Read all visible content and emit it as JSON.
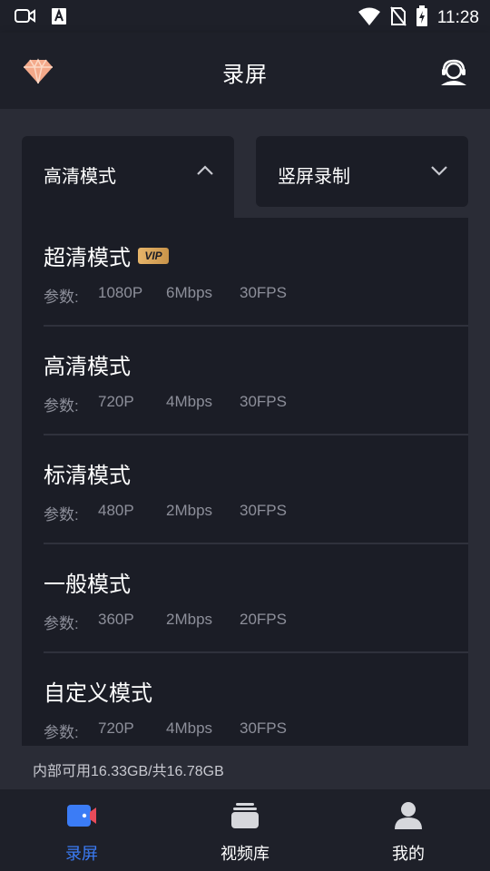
{
  "status_bar": {
    "time": "11:28",
    "icons": [
      "screen-record-icon",
      "font-a-icon",
      "wifi-icon",
      "no-sim-icon",
      "battery-charging-icon"
    ]
  },
  "app_bar": {
    "title": "录屏",
    "left_icon": "diamond-icon",
    "right_icon": "customer-service-icon"
  },
  "selectors": {
    "mode": {
      "label": "高清模式",
      "icon": "chevron-up-icon"
    },
    "orientation": {
      "label": "竖屏录制",
      "icon": "chevron-down-icon"
    }
  },
  "quality_options": [
    {
      "name": "超清模式",
      "badge": "VIP",
      "params_label": "参数:",
      "resolution": "1080P",
      "bitrate": "6Mbps",
      "fps": "30FPS"
    },
    {
      "name": "高清模式",
      "params_label": "参数:",
      "resolution": "720P",
      "bitrate": "4Mbps",
      "fps": "30FPS"
    },
    {
      "name": "标清模式",
      "params_label": "参数:",
      "resolution": "480P",
      "bitrate": "2Mbps",
      "fps": "30FPS"
    },
    {
      "name": "一般模式",
      "params_label": "参数:",
      "resolution": "360P",
      "bitrate": "2Mbps",
      "fps": "20FPS"
    },
    {
      "name": "自定义模式",
      "params_label": "参数:",
      "resolution": "720P",
      "bitrate": "4Mbps",
      "fps": "30FPS"
    }
  ],
  "storage": {
    "text": "内部可用16.33GB/共16.78GB"
  },
  "bottom_nav": [
    {
      "label": "录屏",
      "icon": "record-camera-icon",
      "active": true
    },
    {
      "label": "视频库",
      "icon": "video-library-icon",
      "active": false
    },
    {
      "label": "我的",
      "icon": "profile-icon",
      "active": false
    }
  ],
  "colors": {
    "background": "#1e2029",
    "panel": "#1b1d26",
    "main_area": "#2a2c36",
    "accent": "#3b7cf6",
    "vip_gold": "#e7b56a",
    "secondary_text": "#8d8f9a"
  }
}
